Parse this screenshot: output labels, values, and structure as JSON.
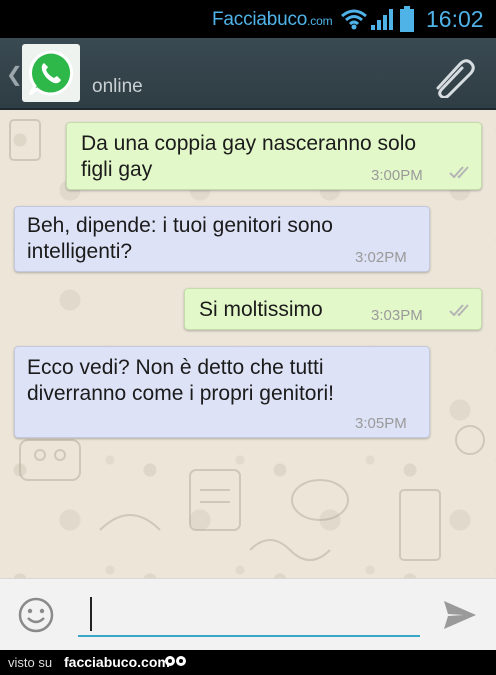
{
  "status_bar": {
    "brand": "Facciabuco",
    "brand_suffix": ".com",
    "time": "16:02",
    "icons": [
      "wifi-icon",
      "signal-icon",
      "battery-icon"
    ]
  },
  "header": {
    "contact_status": "online",
    "icons": [
      "back-icon",
      "whatsapp-icon",
      "attach-icon"
    ]
  },
  "messages": [
    {
      "direction": "out",
      "text_lines": [
        "Da una coppia gay nasceranno solo",
        "figli gay"
      ],
      "time": "3:00PM",
      "ticks": "double"
    },
    {
      "direction": "in",
      "text_lines": [
        "Beh, dipende: i tuoi genitori sono",
        "intelligenti?"
      ],
      "time": "3:02PM"
    },
    {
      "direction": "out",
      "text_lines": [
        "Si moltissimo"
      ],
      "time": "3:03PM",
      "ticks": "double"
    },
    {
      "direction": "in",
      "text_lines": [
        "Ecco vedi? Non è detto che tutti",
        "diverranno come i propri genitori!"
      ],
      "time": "3:05PM"
    }
  ],
  "input_bar": {
    "value": "",
    "icons": [
      "emoji-icon",
      "send-icon"
    ]
  },
  "footer": {
    "visto": "visto su",
    "site": "facciabuco.com"
  },
  "colors": {
    "accent": "#4fb3e8",
    "header_bg": "#34444b",
    "outgoing_bubble": "#e3f8c9",
    "incoming_bubble": "#dde2f6",
    "chat_bg": "#ece5d8",
    "input_underline": "#3aa7c8"
  }
}
